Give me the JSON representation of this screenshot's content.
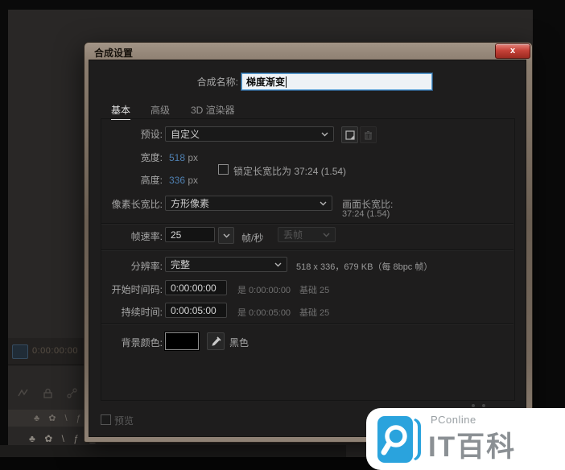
{
  "window": {
    "title": "合成设置",
    "close_glyph": "x"
  },
  "dialog": {
    "name_label": "合成名称:",
    "name_value": "梯度渐变",
    "tabs": {
      "basic": "基本",
      "advanced": "高级",
      "renderer_3d": "3D 渲染器"
    },
    "preset_label": "预设:",
    "preset_value": "自定义",
    "width_label": "宽度:",
    "width_value": "518",
    "width_unit": "px",
    "height_label": "高度:",
    "height_value": "336",
    "height_unit": "px",
    "lock_aspect_label": "锁定长宽比为 37:24 (1.54)",
    "pixel_aspect_label": "像素长宽比:",
    "pixel_aspect_value": "方形像素",
    "frame_aspect_label": "画面长宽比:",
    "frame_aspect_value": "37:24 (1.54)",
    "frame_rate_label": "帧速率:",
    "frame_rate_value": "25",
    "frame_rate_unit": "帧/秒",
    "drop_frame_value": "丢帧",
    "resolution_label": "分辨率:",
    "resolution_value": "完整",
    "resolution_info": "518 x 336，679 KB（每 8bpc 帧）",
    "start_timecode_label": "开始时间码:",
    "start_timecode_value": "0:00:00:00",
    "start_timecode_echo": "是 0:00:00:00",
    "start_timecode_base": "基础 25",
    "duration_label": "持续时间:",
    "duration_value": "0:00:05:00",
    "duration_echo": "是 0:00:05:00",
    "duration_base": "基础 25",
    "bg_color_label": "背景颜色:",
    "bg_color_name": "黑色",
    "bg_color_hex": "#000000",
    "preview_label": "预览"
  },
  "app_background": {
    "timecode": "0:00:00:00",
    "toolbar_icons": "♣ ✿ \\ ƒ",
    "switch_icons": "♣ ✿ \\ ƒ ▢"
  },
  "watermark": {
    "brand": "PConline",
    "title": "IT百科"
  },
  "colors": {
    "value_blue": "#4e7fb0",
    "frame_bronze": "#8a7c6d",
    "close_red": "#c23a2e",
    "watermark_blue": "#2aa3dd",
    "dialog_bg": "#1e1d1d"
  }
}
